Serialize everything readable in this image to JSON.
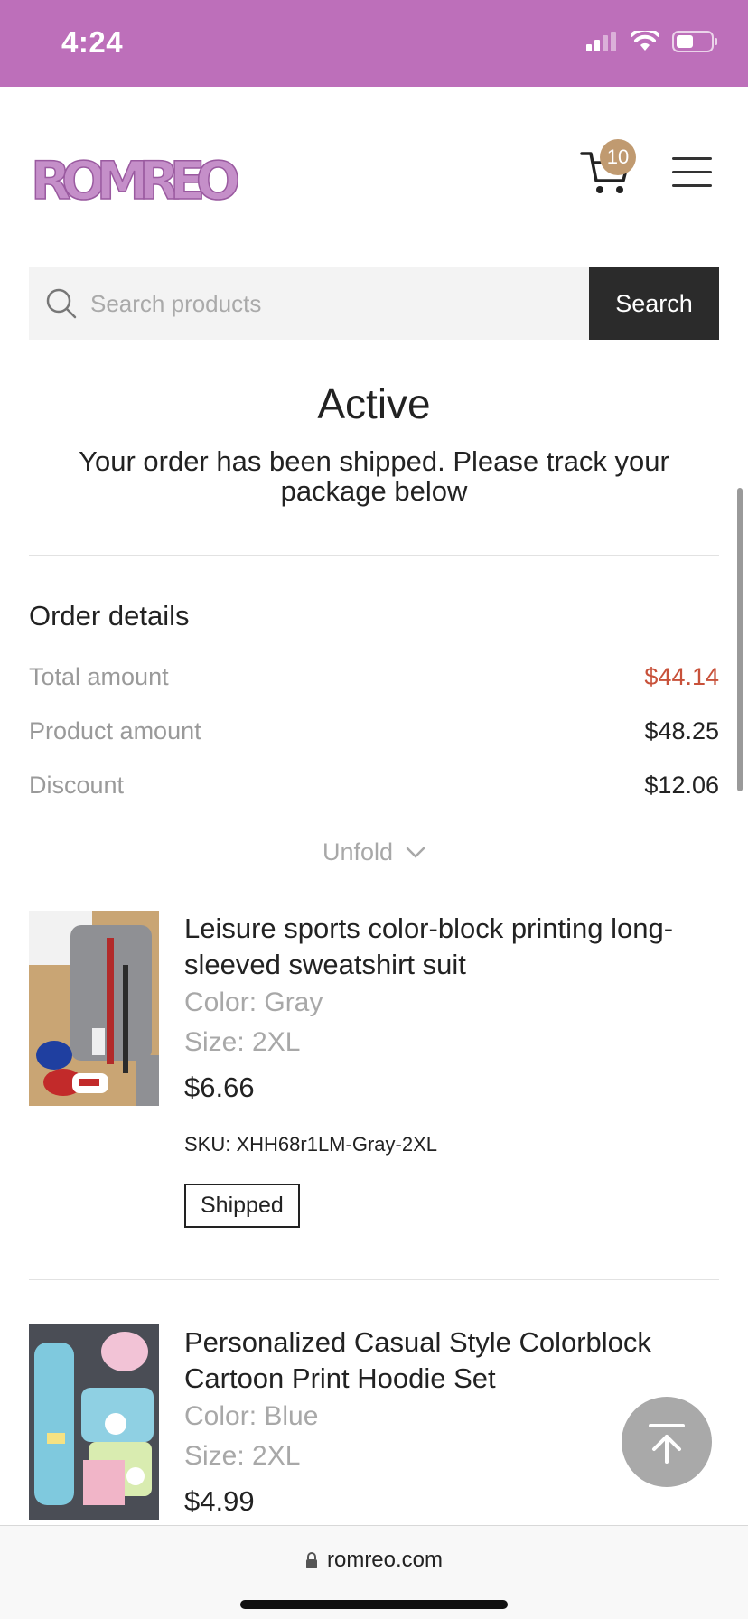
{
  "status_bar": {
    "time": "4:24",
    "background": "#bd6fba"
  },
  "header": {
    "logo_text": "ROMREO",
    "cart_count": "10",
    "icons": [
      "cart-icon",
      "menu-icon"
    ]
  },
  "search": {
    "placeholder": "Search products",
    "value": "",
    "button_label": "Search"
  },
  "order": {
    "status": "Active",
    "message": "Your order has been shipped. Please track your package below"
  },
  "order_details": {
    "title": "Order details",
    "rows": [
      {
        "label": "Total amount",
        "value": "$44.14",
        "accent": "#c8513a"
      },
      {
        "label": "Product amount",
        "value": "$48.25"
      },
      {
        "label": "Discount",
        "value": "$12.06"
      }
    ],
    "unfold_label": "Unfold"
  },
  "products": [
    {
      "name": "Leisure sports color-block printing long-sleeved sweatshirt suit",
      "color": "Color: Gray",
      "size": "Size: 2XL",
      "price": "$6.66",
      "sku": "SKU: XHH68r1LM-Gray-2XL",
      "status": "Shipped"
    },
    {
      "name": "Personalized Casual Style Colorblock Cartoon Print Hoodie Set",
      "color": "Color: Blue",
      "size": "Size: 2XL",
      "price": "$4.99"
    }
  ],
  "browser": {
    "url": "romreo.com"
  }
}
